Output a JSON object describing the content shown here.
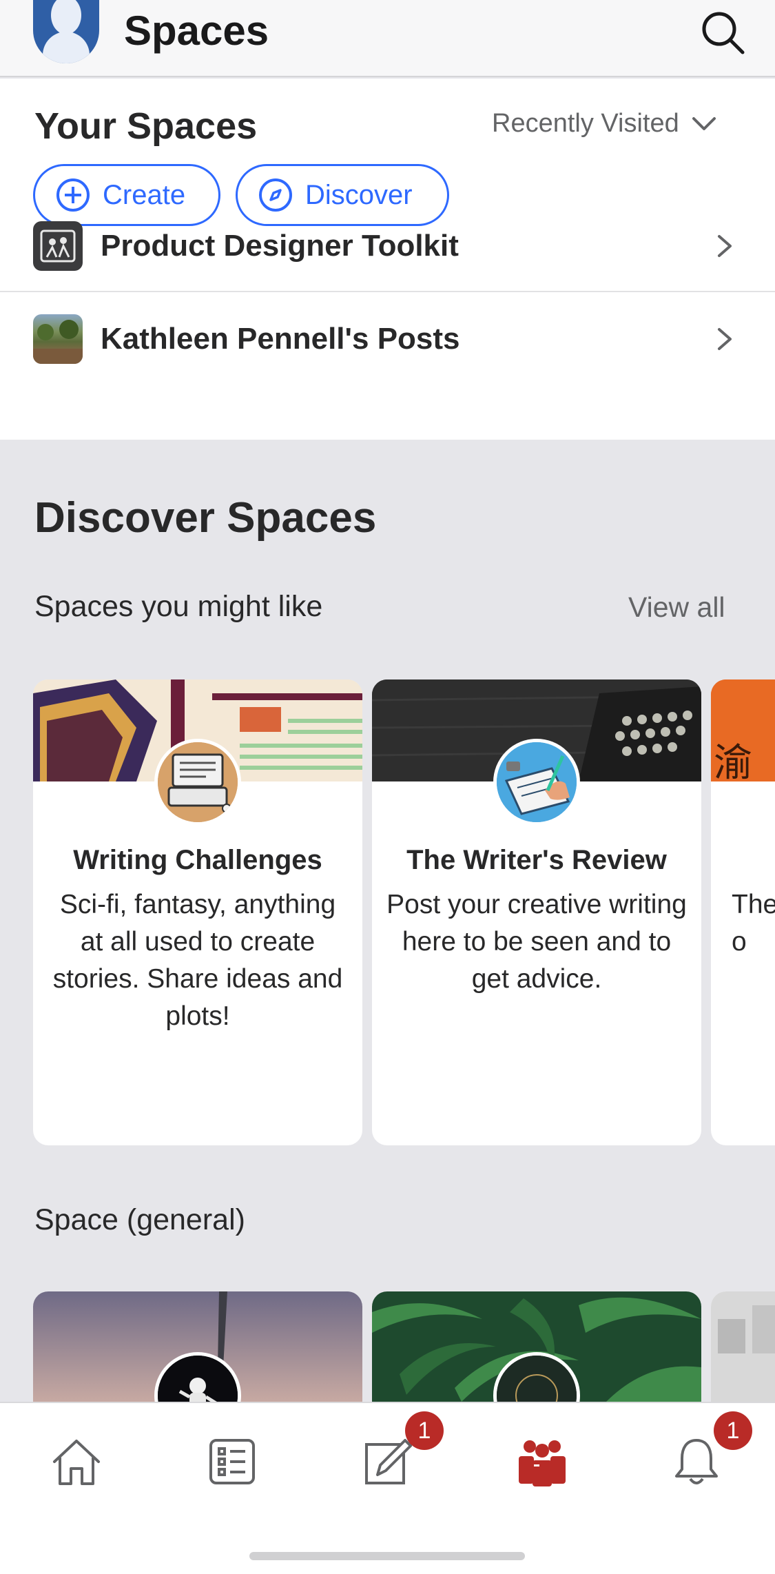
{
  "header": {
    "title": "Spaces",
    "avatar_icon": "user-avatar-icon",
    "search_icon": "search-icon"
  },
  "your_spaces": {
    "title": "Your Spaces",
    "sort_label": "Recently Visited",
    "create_label": "Create",
    "discover_label": "Discover",
    "items": [
      {
        "label": "Product Designer Toolkit",
        "icon": "people-image-icon"
      },
      {
        "label": "Kathleen Pennell's Posts",
        "icon": "park-photo-icon"
      }
    ]
  },
  "discover": {
    "title": "Discover Spaces",
    "section1": {
      "title": "Spaces you might like",
      "view_all": "View all"
    },
    "cards": [
      {
        "title": "Writing Challenges",
        "description": "Sci-fi, fantasy, anything at all used to create stories. Share ideas and plots!"
      },
      {
        "title": "The Writer's Review",
        "description": "Post your creative writing here to be seen and to get advice."
      },
      {
        "title": "",
        "description": "The\no"
      }
    ],
    "section2": {
      "title": "Space (general)"
    }
  },
  "tabbar": {
    "items": [
      {
        "name": "home",
        "icon": "home-icon",
        "badge": ""
      },
      {
        "name": "answer",
        "icon": "list-icon",
        "badge": ""
      },
      {
        "name": "write",
        "icon": "edit-icon",
        "badge": "1"
      },
      {
        "name": "spaces",
        "icon": "spaces-icon",
        "badge": ""
      },
      {
        "name": "notifications",
        "icon": "bell-icon",
        "badge": "1"
      }
    ]
  },
  "colors": {
    "accent": "#2e69ff",
    "brand_red": "#b92b27",
    "background": "#e6e6ea"
  }
}
